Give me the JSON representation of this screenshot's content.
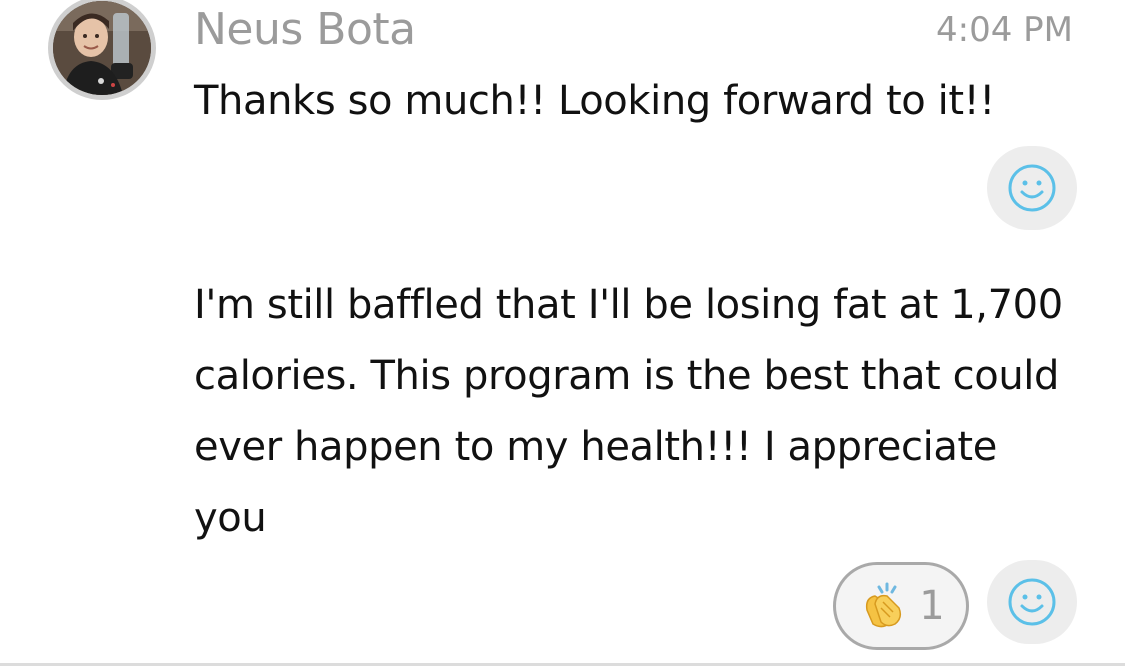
{
  "message_group": {
    "sender_name": "Neus Bota",
    "timestamp": "4:04 PM",
    "messages": [
      {
        "text": "Thanks so much!! Looking forward to it!!"
      },
      {
        "text": "I'm still baffled that I'll be losing fat at 1,700 calories. This program is the best that could ever happen to my health!!! I appreciate you"
      }
    ]
  },
  "reactions": [
    {
      "icon": "clapping-hands-icon",
      "count": "1"
    }
  ],
  "icons": {
    "add_reaction": "smiley-face-icon"
  },
  "colors": {
    "sender_name": "#9b9b9b",
    "message_text": "#111111",
    "smiley_icon": "#5bc0e8",
    "react_button_bg": "#ededed"
  }
}
